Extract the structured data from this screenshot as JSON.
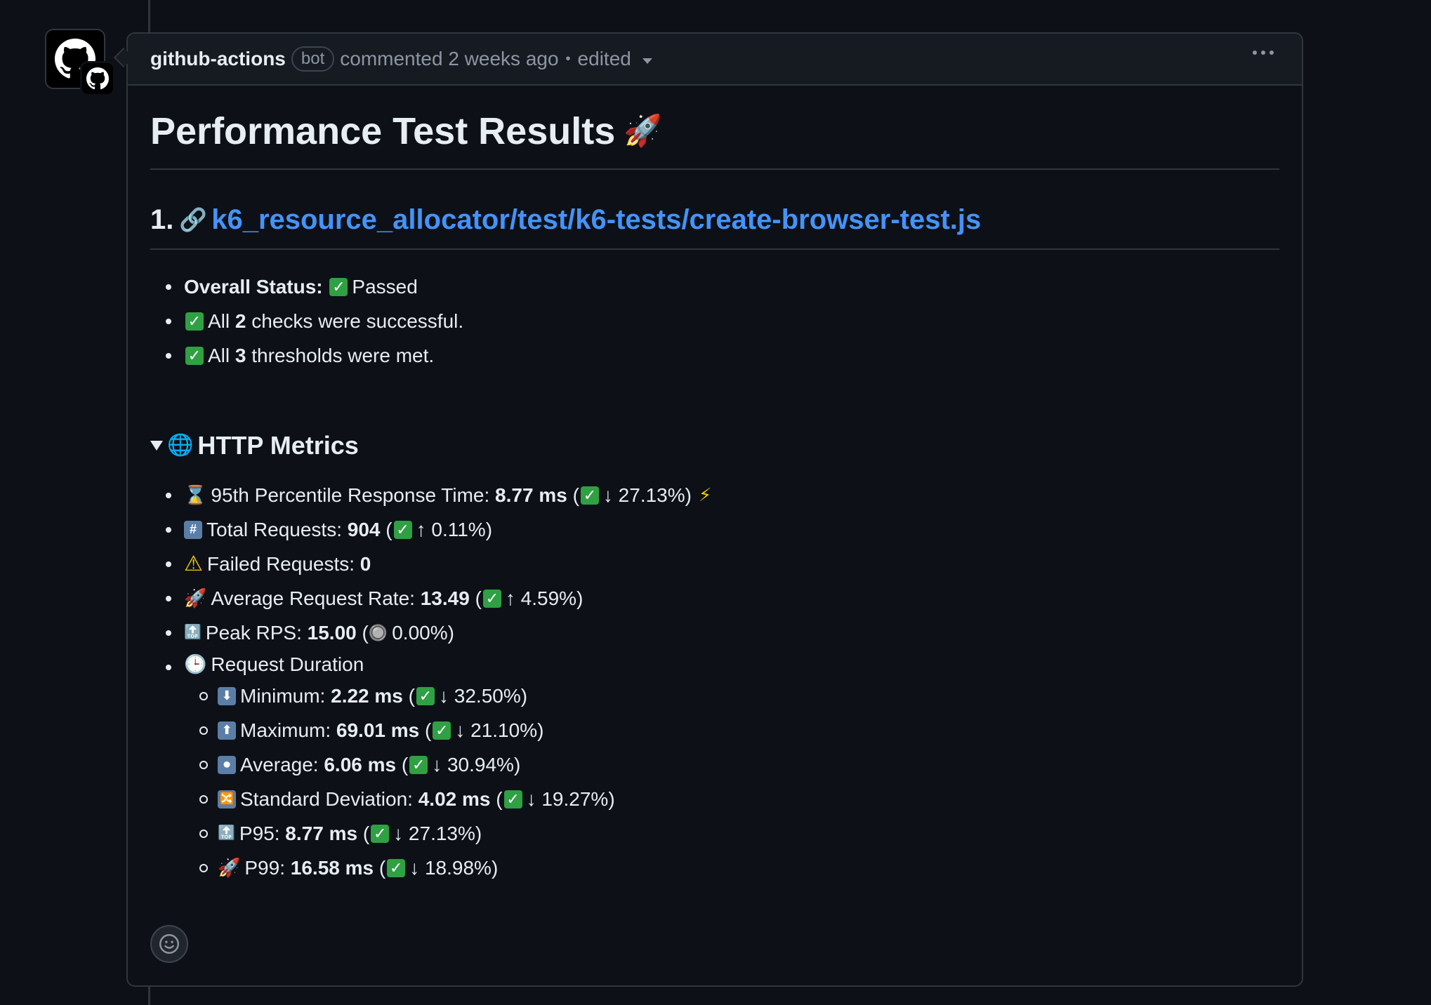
{
  "comment": {
    "author": "github-actions",
    "bot_label": "bot",
    "time_text": "commented 2 weeks ago",
    "edited_text": "edited"
  },
  "title": "Performance Test Results",
  "section": {
    "number": "1.",
    "link_text": "k6_resource_allocator/test/k6-tests/create-browser-test.js"
  },
  "summary": {
    "overall_label": "Overall Status:",
    "overall_value": "Passed",
    "checks_prefix": "All",
    "checks_count": "2",
    "checks_suffix": "checks were successful.",
    "thresholds_prefix": "All",
    "thresholds_count": "3",
    "thresholds_suffix": "thresholds were met."
  },
  "http": {
    "summary_label": "HTTP Metrics",
    "p95": {
      "label": "95th Percentile Response Time:",
      "value": "8.77 ms",
      "change": "↓ 27.13%)"
    },
    "total": {
      "label": "Total Requests:",
      "value": "904",
      "change": "↑ 0.11%)"
    },
    "failed": {
      "label": "Failed Requests:",
      "value": "0"
    },
    "rate": {
      "label": "Average Request Rate:",
      "value": "13.49",
      "change": "↑ 4.59%)"
    },
    "peak": {
      "label": "Peak RPS:",
      "value": "15.00",
      "change": "0.00%)"
    },
    "duration": {
      "label": "Request Duration",
      "min": {
        "label": "Minimum:",
        "value": "2.22 ms",
        "change": "↓ 32.50%)"
      },
      "max": {
        "label": "Maximum:",
        "value": "69.01 ms",
        "change": "↓ 21.10%)"
      },
      "avg": {
        "label": "Average:",
        "value": "6.06 ms",
        "change": "↓ 30.94%)"
      },
      "std": {
        "label": "Standard Deviation:",
        "value": "4.02 ms",
        "change": "↓ 19.27%)"
      },
      "p95": {
        "label": "P95:",
        "value": "8.77 ms",
        "change": "↓ 27.13%)"
      },
      "p99": {
        "label": "P99:",
        "value": "16.58 ms",
        "change": "↓ 18.98%)"
      }
    }
  },
  "icons": {
    "check": "✓",
    "rocket": "🚀",
    "link": "🔗",
    "globe": "🌐",
    "hourglass": "⌛",
    "numbers": "🔢",
    "warning": "⚠",
    "top": "🔝",
    "radio": "🔘",
    "clock": "🕒",
    "down": "⬇",
    "up": "⬆",
    "record": "⏺",
    "shuffle": "🔀",
    "zap": "⚡"
  },
  "colors": {
    "background": "#0d1117",
    "link": "#4493f8",
    "check_green": "#2fa043",
    "border": "#30363d"
  }
}
